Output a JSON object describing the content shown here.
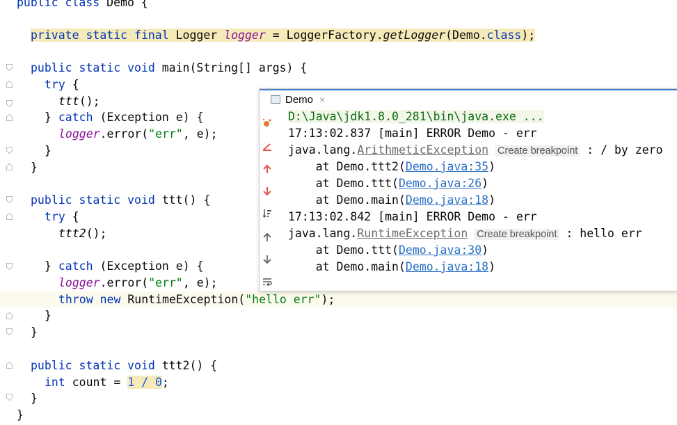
{
  "editor": {
    "lines": [
      {
        "id": "l0",
        "parts": [
          [
            "kw",
            "public class "
          ],
          [
            "",
            "Demo {"
          ]
        ]
      },
      {
        "id": "l1",
        "parts": [
          [
            "kw",
            "private static final "
          ],
          [
            "",
            "Logger "
          ],
          [
            "fld",
            "logger"
          ],
          [
            "",
            " = LoggerFactory."
          ],
          [
            "it",
            "getLogger"
          ],
          [
            "",
            "(Demo."
          ],
          [
            "kw",
            "class"
          ],
          [
            "",
            ");"
          ]
        ]
      },
      {
        "id": "l2",
        "parts": [
          [
            "kw",
            "public static void "
          ],
          [
            "",
            "main(String[] args) {"
          ]
        ]
      },
      {
        "id": "l3",
        "parts": [
          [
            "kw",
            "try "
          ],
          [
            "",
            "{"
          ]
        ]
      },
      {
        "id": "l4",
        "parts": [
          [
            "it",
            "ttt"
          ],
          [
            "",
            "();"
          ]
        ]
      },
      {
        "id": "l5",
        "parts": [
          [
            "",
            "} "
          ],
          [
            "kw",
            "catch "
          ],
          [
            "",
            "(Exception e) {"
          ]
        ]
      },
      {
        "id": "l6",
        "parts": [
          [
            "fld",
            "logger"
          ],
          [
            "",
            ".error("
          ],
          [
            "str",
            "\"err\""
          ],
          [
            "",
            ", e);"
          ]
        ]
      },
      {
        "id": "l7",
        "parts": [
          [
            "",
            "}"
          ]
        ]
      },
      {
        "id": "l8",
        "parts": [
          [
            "",
            "}"
          ]
        ]
      },
      {
        "id": "l9",
        "parts": [
          [
            "kw",
            "public static void "
          ],
          [
            "",
            "ttt() {"
          ]
        ]
      },
      {
        "id": "l10",
        "parts": [
          [
            "kw",
            "try "
          ],
          [
            "",
            "{"
          ]
        ]
      },
      {
        "id": "l11",
        "parts": [
          [
            "it",
            "ttt2"
          ],
          [
            "",
            "();"
          ]
        ]
      },
      {
        "id": "l12",
        "parts": [
          [
            "",
            "} "
          ],
          [
            "kw",
            "catch "
          ],
          [
            "",
            "(Exception e) {"
          ]
        ]
      },
      {
        "id": "l13",
        "parts": [
          [
            "fld",
            "logger"
          ],
          [
            "",
            ".error("
          ],
          [
            "str",
            "\"err\""
          ],
          [
            "",
            ", e);"
          ]
        ]
      },
      {
        "id": "l14",
        "parts": [
          [
            "kw",
            "throw new "
          ],
          [
            "",
            "RuntimeException("
          ],
          [
            "str",
            "\"hello err\""
          ],
          [
            "",
            ");"
          ]
        ]
      },
      {
        "id": "l15",
        "parts": [
          [
            "",
            "}"
          ]
        ]
      },
      {
        "id": "l16",
        "parts": [
          [
            "",
            "}"
          ]
        ]
      },
      {
        "id": "l17",
        "parts": [
          [
            "kw",
            "public static void "
          ],
          [
            "",
            "ttt2() {"
          ]
        ]
      },
      {
        "id": "l18",
        "parts": [
          [
            "kw",
            "int "
          ],
          [
            "",
            "count = "
          ],
          [
            "num",
            "1 / 0"
          ],
          [
            "",
            ";"
          ]
        ]
      },
      {
        "id": "l19",
        "parts": [
          [
            "",
            "}"
          ]
        ]
      },
      {
        "id": "l20",
        "parts": [
          [
            "",
            "}"
          ]
        ]
      }
    ]
  },
  "popup": {
    "tab_title": "Demo",
    "tab_close": "×",
    "console": {
      "cmd": "D:\\Java\\jdk1.8.0_281\\bin\\java.exe ...",
      "log1": "17:13:02.837 [main] ERROR Demo - err",
      "ex1_prefix": "java.lang.",
      "ex1_name": "ArithmeticException",
      "breakpoint_label": "Create breakpoint",
      "ex1_suffix": " : / by zero",
      "at_prefix": "    at ",
      "s1_method": "Demo.ttt2(",
      "s1_link": "Demo.java:35",
      "s2_method": "Demo.ttt(",
      "s2_link": "Demo.java:26",
      "s3_method": "Demo.main(",
      "s3_link": "Demo.java:18",
      "log2": "17:13:02.842 [main] ERROR Demo - err",
      "ex2_prefix": "java.lang.",
      "ex2_name": "RuntimeException",
      "ex2_suffix": " : hello err",
      "s4_method": "Demo.ttt(",
      "s4_link": "Demo.java:30",
      "s5_method": "Demo.main(",
      "s5_link": "Demo.java:18",
      "close_paren": ")"
    }
  },
  "colors": {
    "keyword": "#0033b3",
    "string": "#067d17",
    "field": "#871094",
    "number": "#1750eb",
    "link": "#2a6fc4",
    "highlight": "#f5eaba",
    "popup_accent": "#4083c9"
  }
}
